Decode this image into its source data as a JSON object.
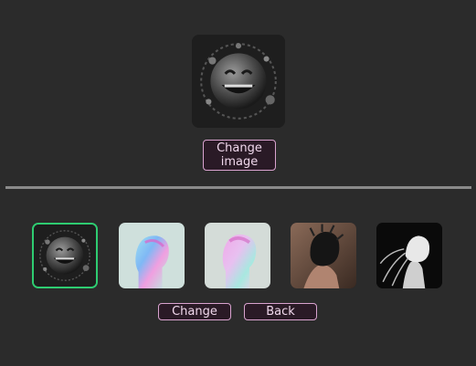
{
  "preview": {
    "image": "smiley-sphere-art"
  },
  "buttons": {
    "change_image": "Change image",
    "change": "Change",
    "back": "Back"
  },
  "gallery": {
    "selected_index": 0,
    "items": [
      {
        "image": "smiley-sphere-art"
      },
      {
        "image": "holographic-head-profile"
      },
      {
        "image": "holographic-head-pink"
      },
      {
        "image": "dark-hair-figure"
      },
      {
        "image": "monochrome-hair-figure"
      }
    ]
  },
  "colors": {
    "background": "#2b2b2b",
    "button_bg": "#2a1a26",
    "button_border": "#d9a3cf",
    "selected_border": "#2ecc71",
    "divider": "#8a8a8a"
  }
}
